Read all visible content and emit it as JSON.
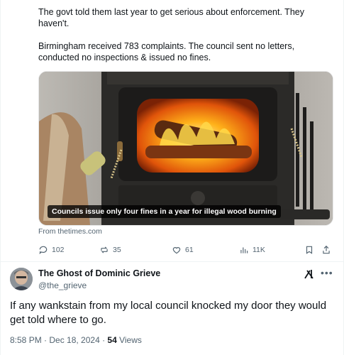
{
  "quoted_post": {
    "paragraph_1": "The govt told them last year to get serious about enforcement. They haven't.",
    "paragraph_2": "Birmingham received 783 complaints. The council sent no letters, conducted no inspections & issued no fines."
  },
  "link_card": {
    "image_subject": "wood-burning stove with fire, logs and fireplace tools",
    "caption": "Councils issue only four fines in a year for illegal wood burning",
    "source": "From thetimes.com"
  },
  "actions": {
    "replies": "102",
    "reposts": "35",
    "likes": "61",
    "views": "11K"
  },
  "reply": {
    "author_name": "The Ghost of Dominic Grieve",
    "author_handle": "@the_grieve",
    "text": "If any wankstain from my local council knocked my door they would get told where to go.",
    "timestamp": "8:58 PM · Dec 18, 2024 · ",
    "views_count": "54",
    "views_label": " Views"
  },
  "colors": {
    "text_primary": "#0f1419",
    "text_secondary": "#536471",
    "divider": "#eff3f4"
  }
}
